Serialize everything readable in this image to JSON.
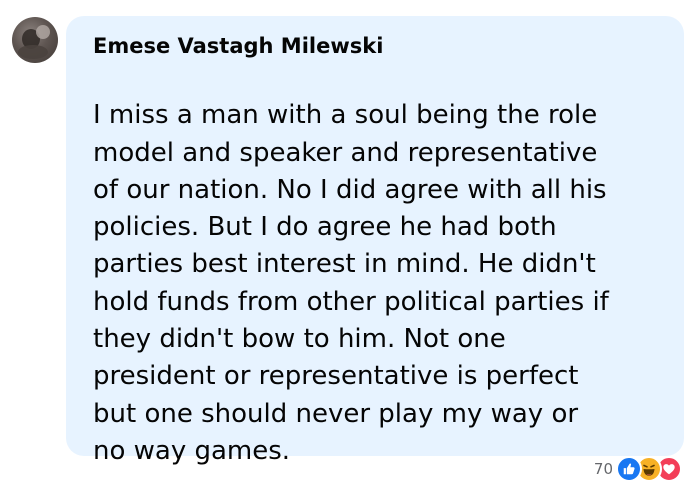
{
  "comment": {
    "author": "Emese Vastagh Milewski",
    "lines": [
      "I miss a man with a soul being the role",
      "model and speaker and representative",
      "of our nation. No I did agree with all his",
      "policies. But I do agree he had both",
      "parties best interest in mind. He didn't",
      "hold funds from other political parties if",
      "they didn't bow to him. Not one",
      "president or representative is perfect",
      "but one should never play my way or",
      "no way games."
    ],
    "reaction_count": "70",
    "reactions": [
      "like-icon",
      "haha-icon",
      "love-icon"
    ]
  },
  "colors": {
    "bubble": "#e7f3ff",
    "text": "#050505",
    "muted": "#65676b",
    "like": "#1877f2",
    "haha": "#f7b125",
    "love": "#f33e58"
  }
}
